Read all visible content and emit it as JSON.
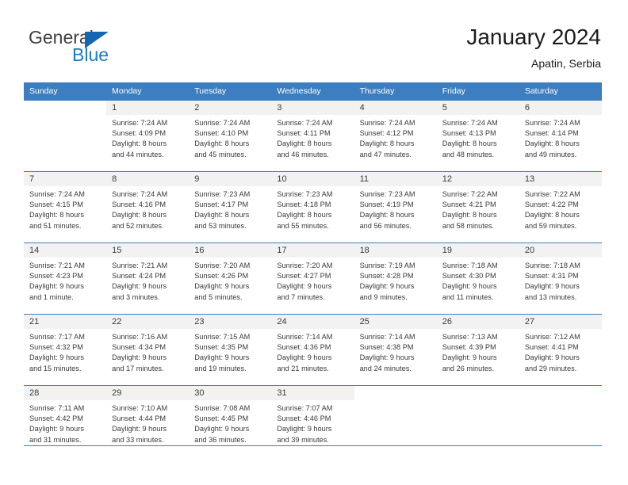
{
  "brand": {
    "name_top": "General",
    "name_bottom": "Blue",
    "triangle_icon": "blue-triangle-logo",
    "color_primary": "#1566b0",
    "color_secondary": "#1a7bc9",
    "color_text": "#3f3f3f"
  },
  "header": {
    "title": "January 2024",
    "subtitle": "Apatin, Serbia"
  },
  "theme": {
    "header_blue": "#3c7ebf",
    "daynum_band": "#f2f2f2",
    "text": "#3a3a3a"
  },
  "calendar": {
    "weekday_headers": [
      "Sunday",
      "Monday",
      "Tuesday",
      "Wednesday",
      "Thursday",
      "Friday",
      "Saturday"
    ],
    "weeks": [
      [
        {
          "day": "",
          "lines": []
        },
        {
          "day": "1",
          "lines": [
            "Sunrise: 7:24 AM",
            "Sunset: 4:09 PM",
            "Daylight: 8 hours",
            "and 44 minutes."
          ]
        },
        {
          "day": "2",
          "lines": [
            "Sunrise: 7:24 AM",
            "Sunset: 4:10 PM",
            "Daylight: 8 hours",
            "and 45 minutes."
          ]
        },
        {
          "day": "3",
          "lines": [
            "Sunrise: 7:24 AM",
            "Sunset: 4:11 PM",
            "Daylight: 8 hours",
            "and 46 minutes."
          ]
        },
        {
          "day": "4",
          "lines": [
            "Sunrise: 7:24 AM",
            "Sunset: 4:12 PM",
            "Daylight: 8 hours",
            "and 47 minutes."
          ]
        },
        {
          "day": "5",
          "lines": [
            "Sunrise: 7:24 AM",
            "Sunset: 4:13 PM",
            "Daylight: 8 hours",
            "and 48 minutes."
          ]
        },
        {
          "day": "6",
          "lines": [
            "Sunrise: 7:24 AM",
            "Sunset: 4:14 PM",
            "Daylight: 8 hours",
            "and 49 minutes."
          ]
        }
      ],
      [
        {
          "day": "7",
          "lines": [
            "Sunrise: 7:24 AM",
            "Sunset: 4:15 PM",
            "Daylight: 8 hours",
            "and 51 minutes."
          ]
        },
        {
          "day": "8",
          "lines": [
            "Sunrise: 7:24 AM",
            "Sunset: 4:16 PM",
            "Daylight: 8 hours",
            "and 52 minutes."
          ]
        },
        {
          "day": "9",
          "lines": [
            "Sunrise: 7:23 AM",
            "Sunset: 4:17 PM",
            "Daylight: 8 hours",
            "and 53 minutes."
          ]
        },
        {
          "day": "10",
          "lines": [
            "Sunrise: 7:23 AM",
            "Sunset: 4:18 PM",
            "Daylight: 8 hours",
            "and 55 minutes."
          ]
        },
        {
          "day": "11",
          "lines": [
            "Sunrise: 7:23 AM",
            "Sunset: 4:19 PM",
            "Daylight: 8 hours",
            "and 56 minutes."
          ]
        },
        {
          "day": "12",
          "lines": [
            "Sunrise: 7:22 AM",
            "Sunset: 4:21 PM",
            "Daylight: 8 hours",
            "and 58 minutes."
          ]
        },
        {
          "day": "13",
          "lines": [
            "Sunrise: 7:22 AM",
            "Sunset: 4:22 PM",
            "Daylight: 8 hours",
            "and 59 minutes."
          ]
        }
      ],
      [
        {
          "day": "14",
          "lines": [
            "Sunrise: 7:21 AM",
            "Sunset: 4:23 PM",
            "Daylight: 9 hours",
            "and 1 minute."
          ]
        },
        {
          "day": "15",
          "lines": [
            "Sunrise: 7:21 AM",
            "Sunset: 4:24 PM",
            "Daylight: 9 hours",
            "and 3 minutes."
          ]
        },
        {
          "day": "16",
          "lines": [
            "Sunrise: 7:20 AM",
            "Sunset: 4:26 PM",
            "Daylight: 9 hours",
            "and 5 minutes."
          ]
        },
        {
          "day": "17",
          "lines": [
            "Sunrise: 7:20 AM",
            "Sunset: 4:27 PM",
            "Daylight: 9 hours",
            "and 7 minutes."
          ]
        },
        {
          "day": "18",
          "lines": [
            "Sunrise: 7:19 AM",
            "Sunset: 4:28 PM",
            "Daylight: 9 hours",
            "and 9 minutes."
          ]
        },
        {
          "day": "19",
          "lines": [
            "Sunrise: 7:18 AM",
            "Sunset: 4:30 PM",
            "Daylight: 9 hours",
            "and 11 minutes."
          ]
        },
        {
          "day": "20",
          "lines": [
            "Sunrise: 7:18 AM",
            "Sunset: 4:31 PM",
            "Daylight: 9 hours",
            "and 13 minutes."
          ]
        }
      ],
      [
        {
          "day": "21",
          "lines": [
            "Sunrise: 7:17 AM",
            "Sunset: 4:32 PM",
            "Daylight: 9 hours",
            "and 15 minutes."
          ]
        },
        {
          "day": "22",
          "lines": [
            "Sunrise: 7:16 AM",
            "Sunset: 4:34 PM",
            "Daylight: 9 hours",
            "and 17 minutes."
          ]
        },
        {
          "day": "23",
          "lines": [
            "Sunrise: 7:15 AM",
            "Sunset: 4:35 PM",
            "Daylight: 9 hours",
            "and 19 minutes."
          ]
        },
        {
          "day": "24",
          "lines": [
            "Sunrise: 7:14 AM",
            "Sunset: 4:36 PM",
            "Daylight: 9 hours",
            "and 21 minutes."
          ]
        },
        {
          "day": "25",
          "lines": [
            "Sunrise: 7:14 AM",
            "Sunset: 4:38 PM",
            "Daylight: 9 hours",
            "and 24 minutes."
          ]
        },
        {
          "day": "26",
          "lines": [
            "Sunrise: 7:13 AM",
            "Sunset: 4:39 PM",
            "Daylight: 9 hours",
            "and 26 minutes."
          ]
        },
        {
          "day": "27",
          "lines": [
            "Sunrise: 7:12 AM",
            "Sunset: 4:41 PM",
            "Daylight: 9 hours",
            "and 29 minutes."
          ]
        }
      ],
      [
        {
          "day": "28",
          "lines": [
            "Sunrise: 7:11 AM",
            "Sunset: 4:42 PM",
            "Daylight: 9 hours",
            "and 31 minutes."
          ]
        },
        {
          "day": "29",
          "lines": [
            "Sunrise: 7:10 AM",
            "Sunset: 4:44 PM",
            "Daylight: 9 hours",
            "and 33 minutes."
          ]
        },
        {
          "day": "30",
          "lines": [
            "Sunrise: 7:08 AM",
            "Sunset: 4:45 PM",
            "Daylight: 9 hours",
            "and 36 minutes."
          ]
        },
        {
          "day": "31",
          "lines": [
            "Sunrise: 7:07 AM",
            "Sunset: 4:46 PM",
            "Daylight: 9 hours",
            "and 39 minutes."
          ]
        },
        {
          "day": "",
          "lines": []
        },
        {
          "day": "",
          "lines": []
        },
        {
          "day": "",
          "lines": []
        }
      ]
    ]
  }
}
